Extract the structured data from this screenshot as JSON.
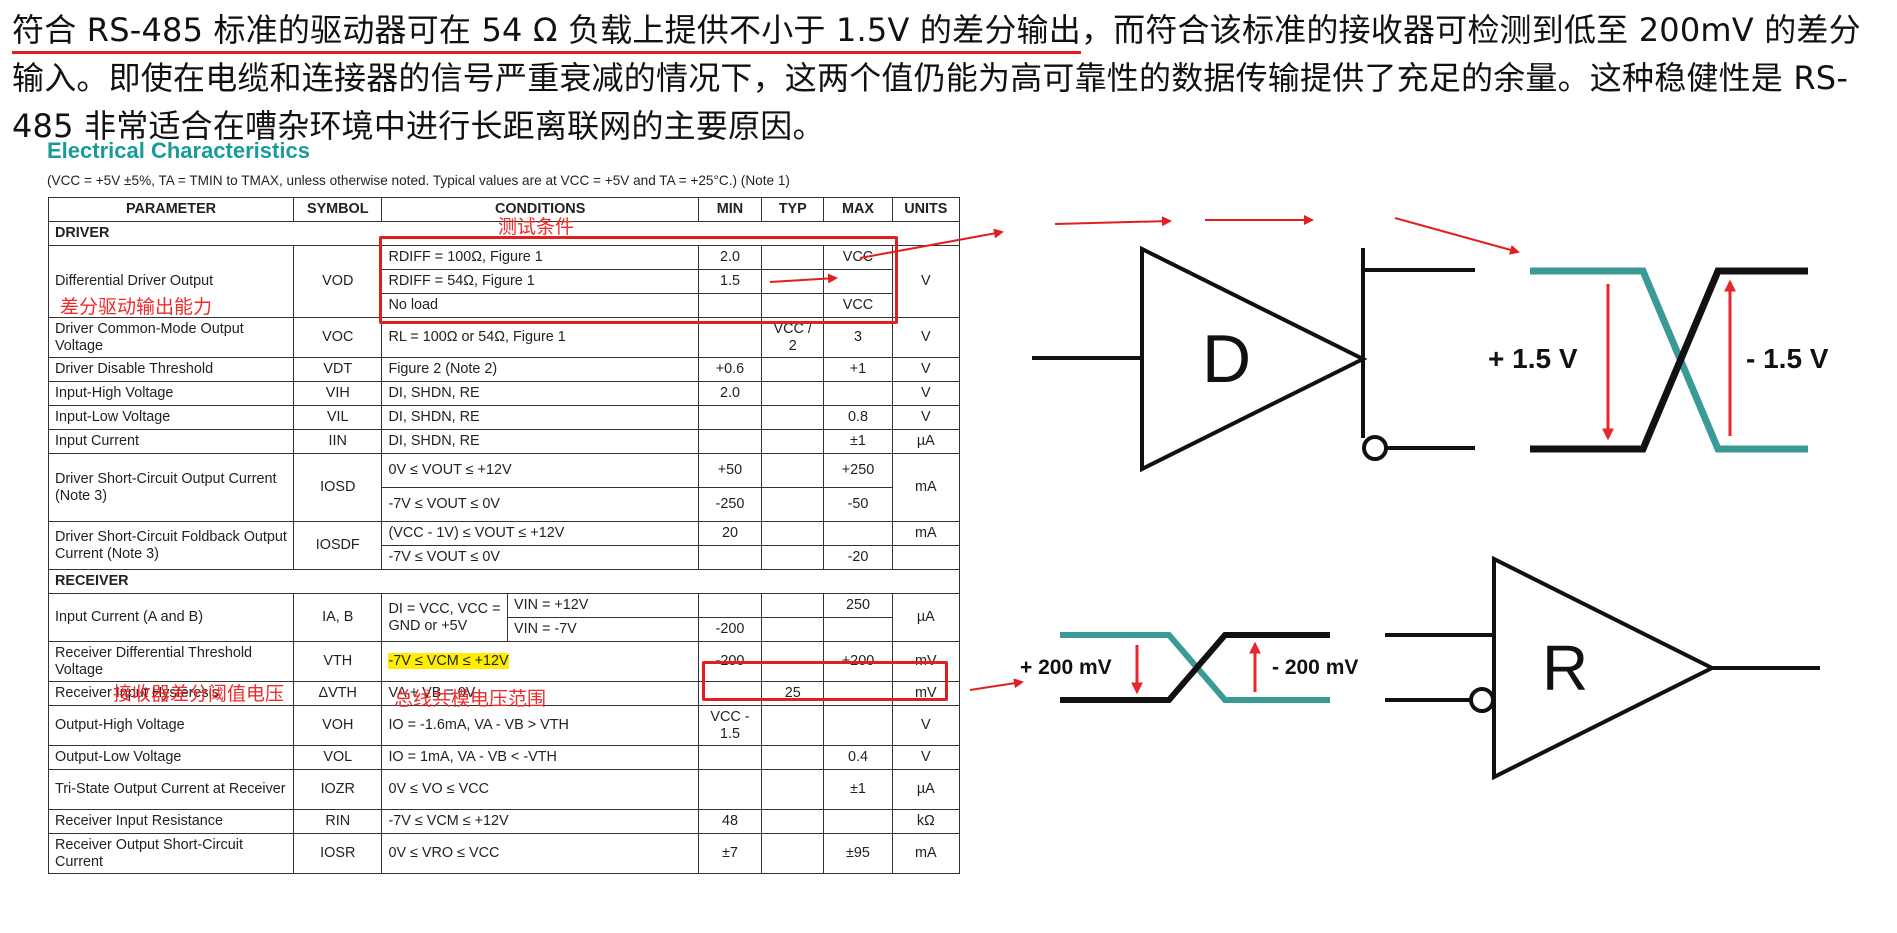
{
  "intro": {
    "highlight": "符合 RS-485 标准的驱动器可在 54 Ω 负载上提供不小于 1.5V 的差分输出",
    "rest": "，而符合该标准的接收器可检测到低至 200mV 的差分输入。即使在电缆和连接器的信号严重衰减的情况下，这两个值仍能为高可靠性的数据传输提供了充足的余量。这种稳健性是 RS-485 非常适合在嘈杂环境中进行长距离联网的主要原因。"
  },
  "datasheet": {
    "title": "Electrical Characteristics",
    "note": "(VCC = +5V ±5%, TA = TMIN to TMAX, unless otherwise noted. Typical values are at VCC = +5V and TA = +25°C.) (Note 1)",
    "headers": [
      "PARAMETER",
      "SYMBOL",
      "CONDITIONS",
      "MIN",
      "TYP",
      "MAX",
      "UNITS"
    ],
    "driver_section": "DRIVER",
    "receiver_section": "RECEIVER",
    "rows": {
      "vod": {
        "param": "Differential Driver Output",
        "sym": "VOD",
        "c1": "RDIFF = 100Ω, Figure 1",
        "min1": "2.0",
        "max1": "VCC",
        "c2": "RDIFF = 54Ω, Figure 1",
        "min2": "1.5",
        "c3": "No load",
        "max3": "VCC",
        "unit": "V"
      },
      "voc": {
        "param": "Driver Common-Mode Output Voltage",
        "sym": "VOC",
        "cond": "RL = 100Ω or 54Ω, Figure 1",
        "typ": "VCC / 2",
        "max": "3",
        "unit": "V"
      },
      "vdt": {
        "param": "Driver Disable Threshold",
        "sym": "VDT",
        "cond": "Figure 2 (Note 2)",
        "min": "+0.6",
        "max": "+1",
        "unit": "V"
      },
      "vih": {
        "param": "Input-High Voltage",
        "sym": "VIH",
        "cond": "DI, SHDN, RE",
        "min": "2.0",
        "unit": "V"
      },
      "vil": {
        "param": "Input-Low Voltage",
        "sym": "VIL",
        "cond": "DI, SHDN, RE",
        "max": "0.8",
        "unit": "V"
      },
      "iin": {
        "param": "Input Current",
        "sym": "IIN",
        "cond": "DI, SHDN, RE",
        "max": "±1",
        "unit": "µA"
      },
      "iosd": {
        "param": "Driver Short-Circuit Output Current (Note 3)",
        "sym": "IOSD",
        "c1": "0V ≤ VOUT ≤ +12V",
        "min1": "+50",
        "max1": "+250",
        "c2": "-7V ≤ VOUT ≤ 0V",
        "min2": "-250",
        "max2": "-50",
        "unit": "mA"
      },
      "iosdf": {
        "param": "Driver Short-Circuit Foldback Output Current (Note 3)",
        "sym": "IOSDF",
        "c1": "(VCC - 1V) ≤ VOUT ≤ +12V",
        "min1": "20",
        "unit1": "mA",
        "c2": "-7V ≤ VOUT ≤ 0V",
        "max2": "-20"
      },
      "iab": {
        "param": "Input Current (A and B)",
        "sym": "IA, B",
        "cond_left": "DI = VCC, VCC = GND or +5V",
        "c1": "VIN = +12V",
        "max1": "250",
        "c2": "VIN = -7V",
        "min2": "-200",
        "unit": "µA"
      },
      "vth": {
        "param": "Receiver Differential Threshold Voltage",
        "sym": "VTH",
        "cond": "-7V ≤ VCM ≤ +12V",
        "min": "-200",
        "max": "+200",
        "unit": "mV"
      },
      "dvth": {
        "param": "Receiver Input Hysteresis",
        "sym": "ΔVTH",
        "cond": "VA + VB = 0V",
        "typ": "25",
        "unit": "mV"
      },
      "voh": {
        "param": "Output-High Voltage",
        "sym": "VOH",
        "cond": "IO = -1.6mA, VA - VB > VTH",
        "min": "VCC - 1.5",
        "unit": "V"
      },
      "vol": {
        "param": "Output-Low Voltage",
        "sym": "VOL",
        "cond": "IO = 1mA, VA - VB < -VTH",
        "max": "0.4",
        "unit": "V"
      },
      "iozr": {
        "param": "Tri-State Output Current at Receiver",
        "sym": "IOZR",
        "cond": "0V ≤ VO ≤ VCC",
        "max": "±1",
        "unit": "µA"
      },
      "rin": {
        "param": "Receiver Input Resistance",
        "sym": "RIN",
        "cond": "-7V ≤ VCM ≤ +12V",
        "min": "48",
        "unit": "kΩ"
      },
      "iosr": {
        "param": "Receiver Output Short-Circuit Current",
        "sym": "IOSR",
        "cond": "0V ≤ VRO ≤ VCC",
        "min": "±7",
        "max": "±95",
        "unit": "mA"
      }
    }
  },
  "annotations": {
    "test_conditions": "测试条件",
    "driver_ability": "差分驱动输出能力",
    "receiver_threshold": "接收器差分阈值电压",
    "bus_cm_range": "总线共模电压范围",
    "color": "#e02020"
  },
  "diagram": {
    "driver_label": "D",
    "receiver_label": "R",
    "driver_pos": "+ 1.5 V",
    "driver_neg": "- 1.5 V",
    "receiver_pos": "+ 200 mV",
    "receiver_neg": "- 200 mV",
    "teal": "#3a9a96",
    "red": "#e8262e"
  }
}
